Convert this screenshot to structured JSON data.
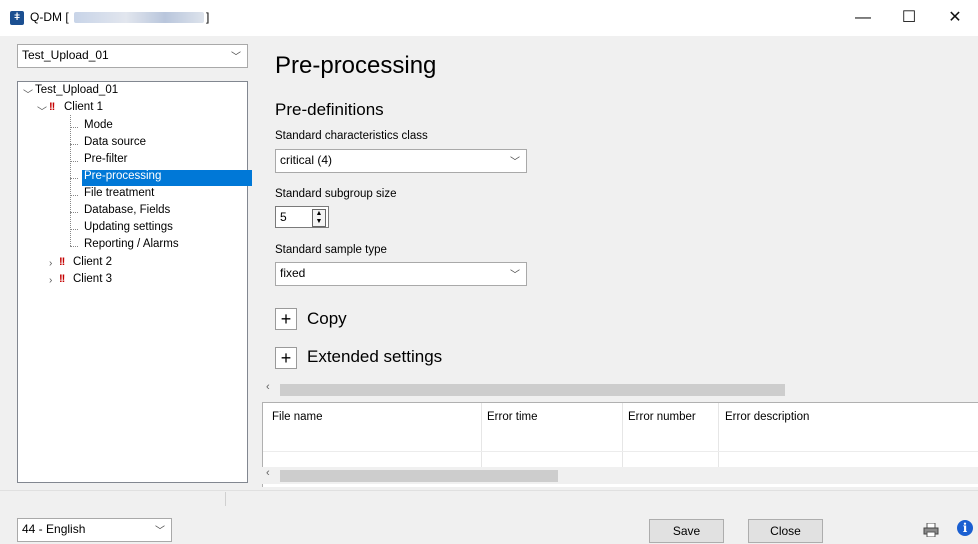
{
  "window": {
    "title": "Q-DM [",
    "title_suffix": "]",
    "minimize_glyph": "—",
    "maximize_glyph": "☐",
    "close_glyph": "✕"
  },
  "profile_select": {
    "value": "Test_Upload_01"
  },
  "tree": {
    "root": "Test_Upload_01",
    "clients": [
      {
        "label": "Client 1",
        "expanded": true
      },
      {
        "label": "Client 2",
        "expanded": false
      },
      {
        "label": "Client 3",
        "expanded": false
      }
    ],
    "client1_items": [
      "Mode",
      "Data source",
      "Pre-filter",
      "Pre-processing",
      "File treatment",
      "Database, Fields",
      "Updating settings",
      "Reporting / Alarms"
    ],
    "selected": "Pre-processing",
    "warning_icon": "exclamation-warning-icon"
  },
  "main": {
    "title": "Pre-processing",
    "section": "Pre-definitions",
    "class_label": "Standard characteristics class",
    "class_value": "critical (4)",
    "subgroup_label": "Standard subgroup size",
    "subgroup_value": "5",
    "sample_label": "Standard sample type",
    "sample_value": "fixed",
    "copy_label": "Copy",
    "extended_label": "Extended settings"
  },
  "grid": {
    "columns": [
      "File name",
      "Error time",
      "Error number",
      "Error description"
    ]
  },
  "footer": {
    "language": "44 - English",
    "save_label": "Save",
    "close_label": "Close"
  },
  "colors": {
    "selection": "#0078d7",
    "warning": "#c40000",
    "info": "#1a5fd1"
  }
}
